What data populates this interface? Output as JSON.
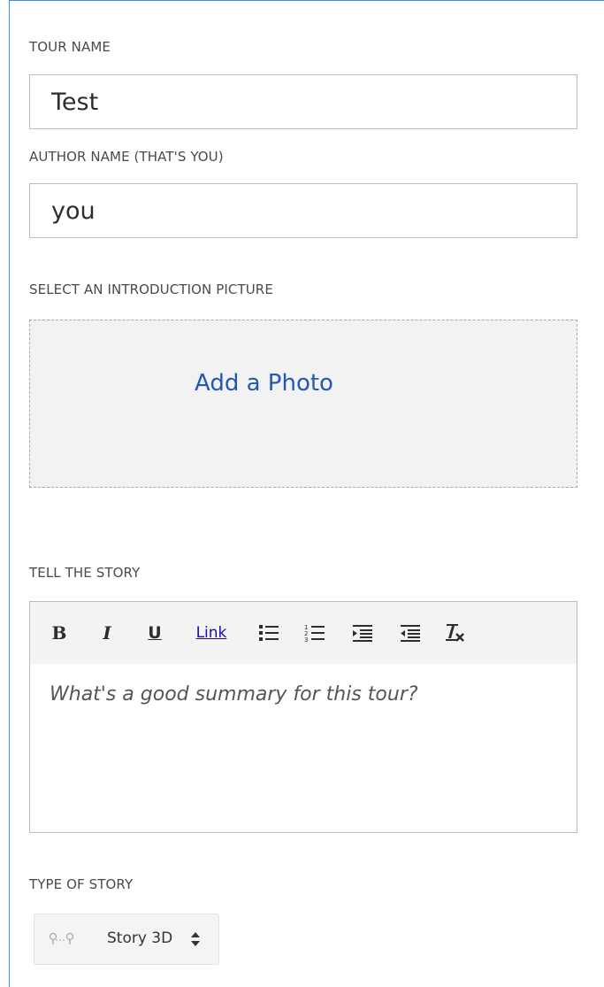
{
  "tour_name": {
    "label": "TOUR NAME",
    "value": "Test"
  },
  "author_name": {
    "label": "AUTHOR NAME (THAT'S YOU)",
    "value": "you"
  },
  "intro_picture": {
    "label": "SELECT AN INTRODUCTION PICTURE",
    "action_label": "Add a Photo"
  },
  "story": {
    "label": "TELL THE STORY",
    "toolbar": {
      "bold": "B",
      "italic": "I",
      "underline": "U",
      "link": "Link",
      "icons": [
        "bulleted-list-icon",
        "numbered-list-icon",
        "indent-icon",
        "outdent-icon",
        "clear-formatting-icon"
      ]
    },
    "placeholder": "What's a good summary for this tour?"
  },
  "story_type": {
    "label": "TYPE OF STORY",
    "selected": "Story 3D",
    "icon": "map-pins-icon"
  },
  "colors": {
    "accent_border": "#3c8fde",
    "link": "#2158b5",
    "drop_area": "#f2f2f2",
    "toolbar": "#f3f3f3"
  }
}
